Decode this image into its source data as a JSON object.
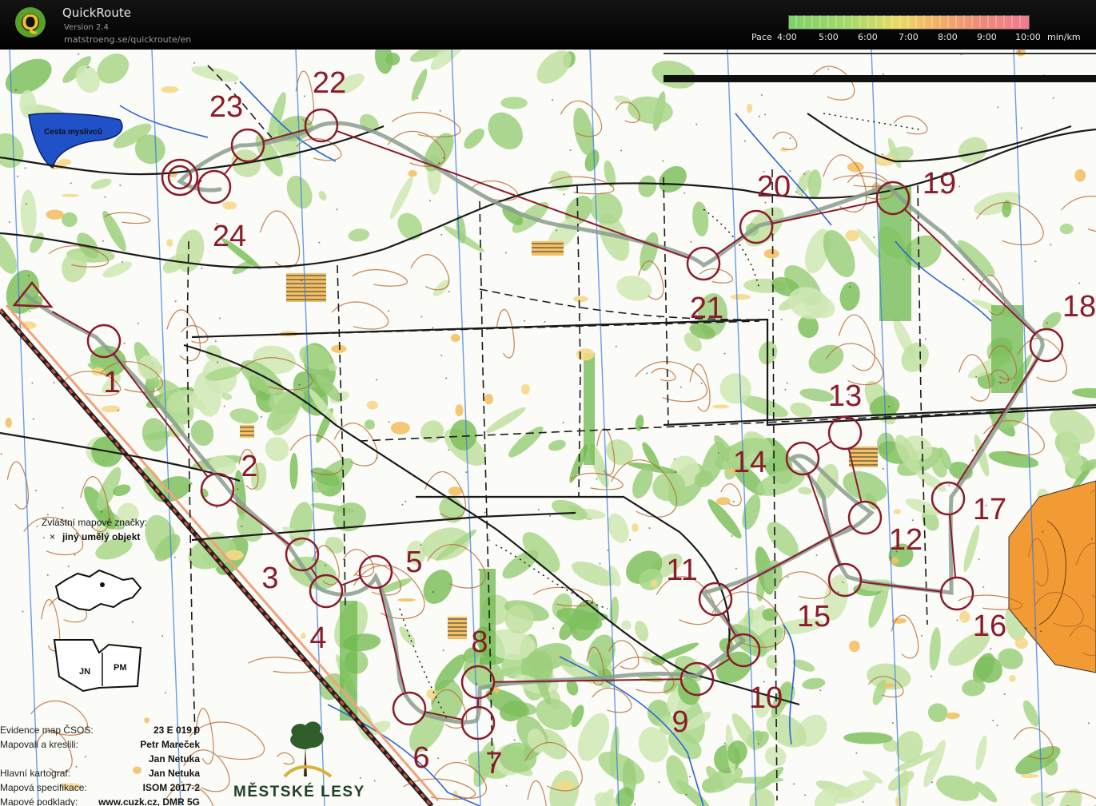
{
  "app": {
    "title": "QuickRoute",
    "version": "Version 2.4",
    "url": "matstroeng.se/quickroute/en"
  },
  "pace_scale": {
    "label": "Pace",
    "ticks": [
      "4:00",
      "5:00",
      "6:00",
      "7:00",
      "8:00",
      "9:00",
      "10:00"
    ],
    "unit": "min/km",
    "colors": [
      "#7fd06a",
      "#a7d86a",
      "#e6dc66",
      "#f2b566",
      "#ee8b78",
      "#f07a8e"
    ]
  },
  "map": {
    "lake_label": "Cesta myslivců",
    "special_symbols_title": "Zvláštní mapové značky:",
    "special_symbol": "jiný umělý objekt",
    "inset_labels": [
      "JN",
      "PM"
    ],
    "metadata": [
      {
        "label": "Evidence map ČSOS:",
        "value": "23 E 019 0"
      },
      {
        "label": "Mapovali a kreslili:",
        "value": "Petr Mareček"
      },
      {
        "label": "",
        "value": "Jan Netuka"
      },
      {
        "label": "Hlavní kartograf:",
        "value": "Jan Netuka"
      },
      {
        "label": "Mapová specifikace:",
        "value": "ISOM 2017-2"
      },
      {
        "label": "Mapové podklady:",
        "value": "www.cuzk.cz, DMR 5G"
      }
    ],
    "brand": "MĚSTSKÉ LESY",
    "course_color": "#8b1a2a",
    "route_color": "#8a9e8e",
    "controls": [
      {
        "label": "1"
      },
      {
        "label": "2"
      },
      {
        "label": "3"
      },
      {
        "label": "4"
      },
      {
        "label": "5"
      },
      {
        "label": "6"
      },
      {
        "label": "7"
      },
      {
        "label": "8"
      },
      {
        "label": "9"
      },
      {
        "label": "10"
      },
      {
        "label": "11"
      },
      {
        "label": "12"
      },
      {
        "label": "13"
      },
      {
        "label": "14"
      },
      {
        "label": "15"
      },
      {
        "label": "16"
      },
      {
        "label": "17"
      },
      {
        "label": "18"
      },
      {
        "label": "19"
      },
      {
        "label": "20"
      },
      {
        "label": "21"
      },
      {
        "label": "22"
      },
      {
        "label": "23"
      },
      {
        "label": "24"
      }
    ]
  }
}
